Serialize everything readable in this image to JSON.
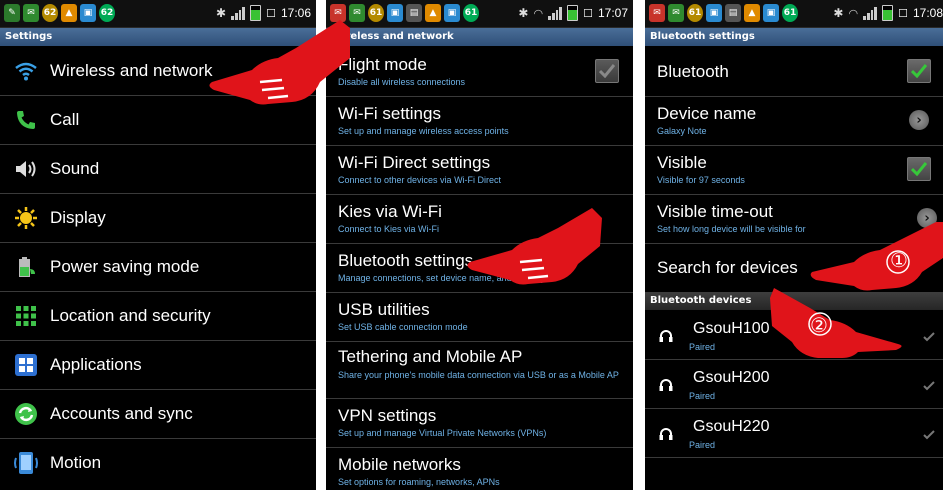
{
  "panel1": {
    "status_time": "17:06",
    "status_badges": [
      "62",
      "62"
    ],
    "title": "Settings",
    "items": [
      {
        "label": "Wireless and network",
        "icon": "wifi-icon"
      },
      {
        "label": "Call",
        "icon": "phone-icon"
      },
      {
        "label": "Sound",
        "icon": "speaker-icon"
      },
      {
        "label": "Display",
        "icon": "display-icon"
      },
      {
        "label": "Power saving mode",
        "icon": "battery-icon"
      },
      {
        "label": "Location and security",
        "icon": "location-grid-icon"
      },
      {
        "label": "Applications",
        "icon": "apps-grid-icon"
      },
      {
        "label": "Accounts and sync",
        "icon": "sync-icon"
      },
      {
        "label": "Motion",
        "icon": "motion-icon"
      }
    ]
  },
  "panel2": {
    "status_time": "17:07",
    "status_badges": [
      "61",
      "61"
    ],
    "title": "Wireless and network",
    "items": [
      {
        "title": "Flight mode",
        "sub": "Disable all wireless connections"
      },
      {
        "title": "Wi-Fi settings",
        "sub": "Set up and manage wireless access points"
      },
      {
        "title": "Wi-Fi Direct settings",
        "sub": "Connect to other devices via Wi-Fi Direct"
      },
      {
        "title": "Kies via Wi-Fi",
        "sub": "Connect to Kies via Wi-Fi"
      },
      {
        "title": "Bluetooth settings",
        "sub": "Manage connections, set device name, and visibility"
      },
      {
        "title": "USB utilities",
        "sub": "Set USB cable connection mode"
      },
      {
        "title": "Tethering and Mobile AP",
        "sub": "Share your phone's mobile data connection via USB or as a Mobile AP"
      },
      {
        "title": "VPN settings",
        "sub": "Set up and manage Virtual Private Networks (VPNs)"
      },
      {
        "title": "Mobile networks",
        "sub": "Set options for roaming, networks, APNs"
      }
    ]
  },
  "panel3": {
    "status_time": "17:08",
    "status_badges": [
      "61",
      "61"
    ],
    "title": "Bluetooth settings",
    "bluetooth": {
      "label": "Bluetooth"
    },
    "device_name": {
      "label": "Device name",
      "value": "Galaxy Note"
    },
    "visible": {
      "label": "Visible",
      "sub": "Visible for 97 seconds"
    },
    "visible_timeout": {
      "label": "Visible time-out",
      "sub": "Set how long device will be visible for"
    },
    "search": {
      "label": "Search for devices"
    },
    "section_title": "Bluetooth devices",
    "devices": [
      {
        "name": "GsouH100",
        "status": "Paired"
      },
      {
        "name": "GsouH200",
        "status": "Paired"
      },
      {
        "name": "GsouH220",
        "status": "Paired"
      }
    ]
  },
  "annotations": {
    "step1": "①",
    "step2": "②"
  },
  "colors": {
    "accent_blue": "#6fb2e6",
    "check_green": "#37c83a",
    "hand_red": "#e0141a",
    "title_blue": "#3a5f8c"
  }
}
